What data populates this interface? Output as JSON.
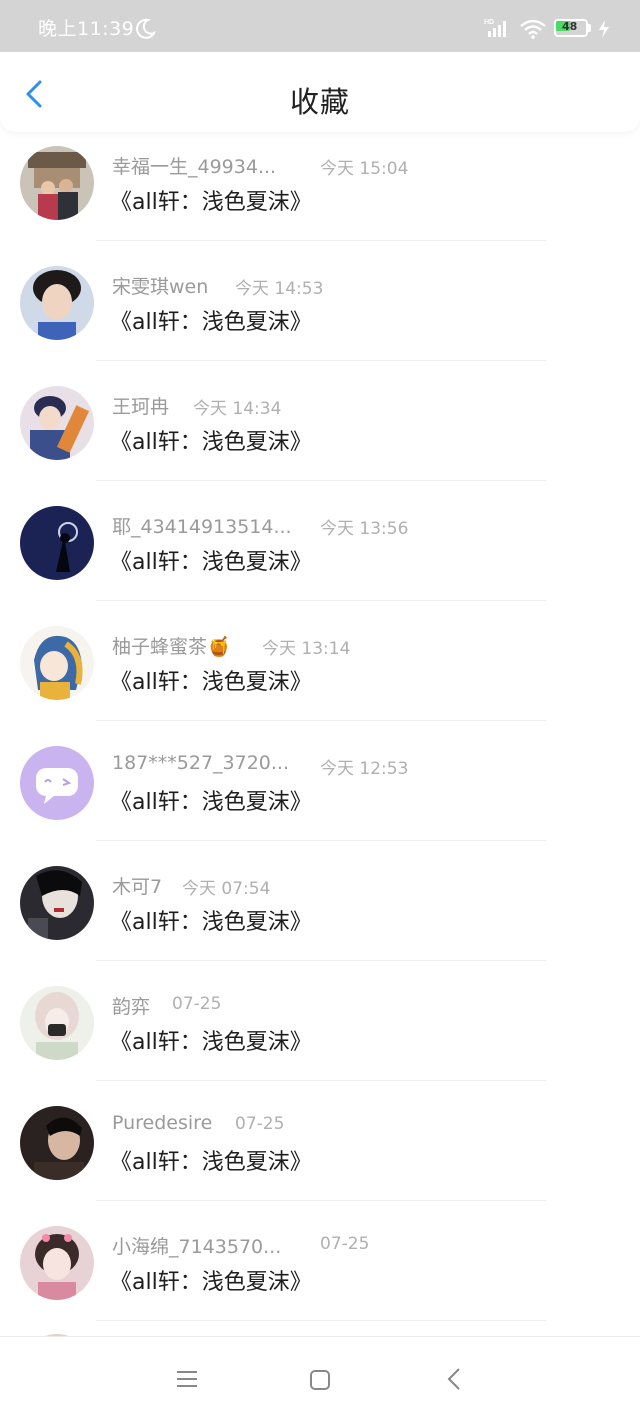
{
  "status_bar": {
    "time": "晚上11:39",
    "battery": "48",
    "icons": [
      "moon-icon",
      "hd-signal-icon",
      "wifi-icon",
      "battery-icon",
      "charging-icon"
    ]
  },
  "header": {
    "title": "收藏",
    "back_icon": "chevron-left-icon"
  },
  "items": [
    {
      "name": "幸福一生_49934...",
      "time": "今天 15:04",
      "title": "《all轩：浅色夏沫》"
    },
    {
      "name": "宋雯琪wen",
      "time": "今天 14:53",
      "title": "《all轩：浅色夏沫》"
    },
    {
      "name": "王珂冉",
      "time": "今天 14:34",
      "title": "《all轩：浅色夏沫》"
    },
    {
      "name": "耶_43414913514...",
      "time": "今天 13:56",
      "title": "《all轩：浅色夏沫》"
    },
    {
      "name": "柚子蜂蜜茶🍯",
      "time": "今天 13:14",
      "title": "《all轩：浅色夏沫》"
    },
    {
      "name": "187***527_3720...",
      "time": "今天 12:53",
      "title": "《all轩：浅色夏沫》"
    },
    {
      "name": "木可7",
      "time": "今天 07:54",
      "title": "《all轩：浅色夏沫》"
    },
    {
      "name": "韵弈",
      "time": "07-25",
      "title": "《all轩：浅色夏沫》"
    },
    {
      "name": "Puredesire",
      "time": "07-25",
      "title": "《all轩：浅色夏沫》"
    },
    {
      "name": "小海绵_7143570...",
      "time": "07-25",
      "title": "《all轩：浅色夏沫》"
    }
  ],
  "bottom_nav": {
    "icons": [
      "menu-icon",
      "home-icon",
      "back-icon"
    ]
  },
  "colors": {
    "accent": "#2b8ff6",
    "name_gray": "#9a9a9a",
    "time_gray": "#b0b0b0",
    "status_bg": "#d4d4d4"
  }
}
